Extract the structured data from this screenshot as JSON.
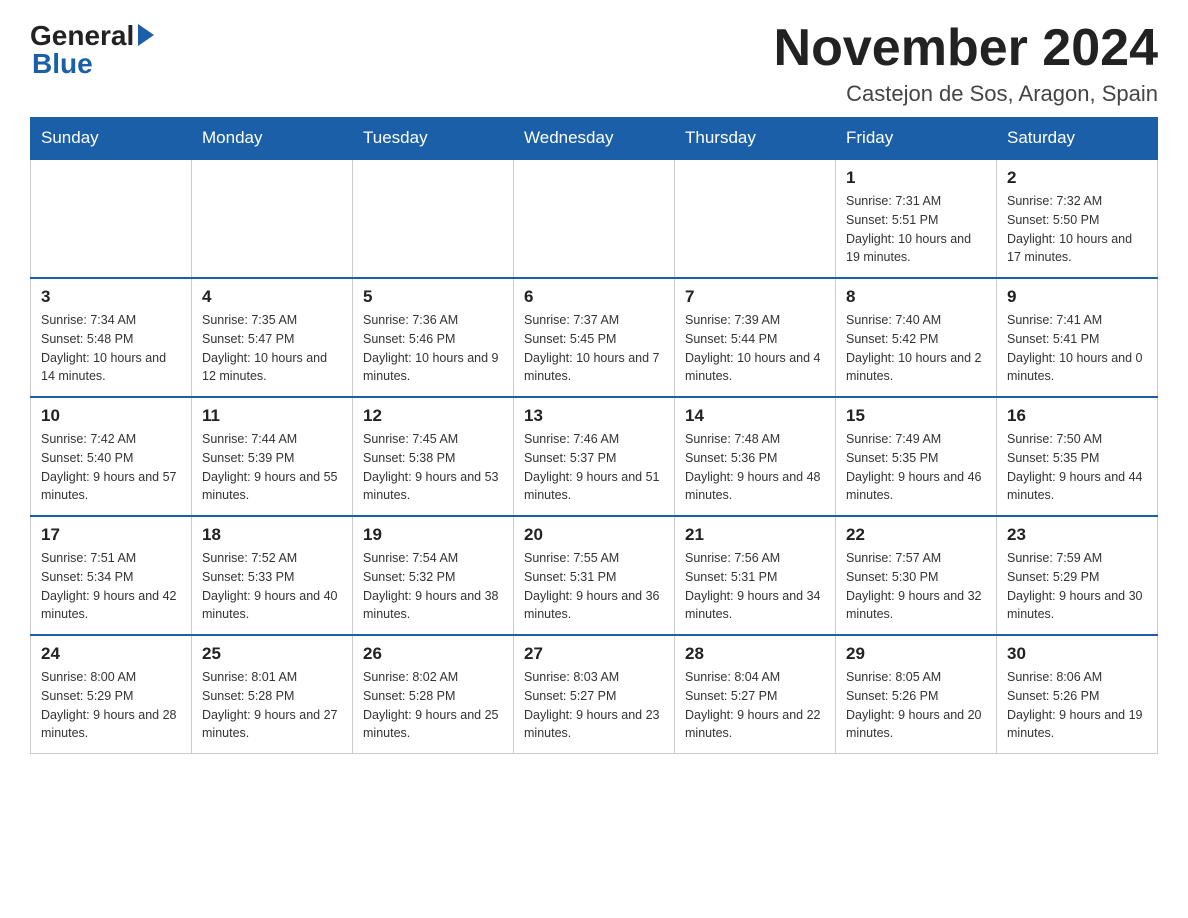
{
  "header": {
    "month_title": "November 2024",
    "location": "Castejon de Sos, Aragon, Spain"
  },
  "days_of_week": [
    "Sunday",
    "Monday",
    "Tuesday",
    "Wednesday",
    "Thursday",
    "Friday",
    "Saturday"
  ],
  "weeks": [
    [
      {
        "day": "",
        "sunrise": "",
        "sunset": "",
        "daylight": "",
        "empty": true
      },
      {
        "day": "",
        "sunrise": "",
        "sunset": "",
        "daylight": "",
        "empty": true
      },
      {
        "day": "",
        "sunrise": "",
        "sunset": "",
        "daylight": "",
        "empty": true
      },
      {
        "day": "",
        "sunrise": "",
        "sunset": "",
        "daylight": "",
        "empty": true
      },
      {
        "day": "",
        "sunrise": "",
        "sunset": "",
        "daylight": "",
        "empty": true
      },
      {
        "day": "1",
        "sunrise": "Sunrise: 7:31 AM",
        "sunset": "Sunset: 5:51 PM",
        "daylight": "Daylight: 10 hours and 19 minutes.",
        "empty": false
      },
      {
        "day": "2",
        "sunrise": "Sunrise: 7:32 AM",
        "sunset": "Sunset: 5:50 PM",
        "daylight": "Daylight: 10 hours and 17 minutes.",
        "empty": false
      }
    ],
    [
      {
        "day": "3",
        "sunrise": "Sunrise: 7:34 AM",
        "sunset": "Sunset: 5:48 PM",
        "daylight": "Daylight: 10 hours and 14 minutes.",
        "empty": false
      },
      {
        "day": "4",
        "sunrise": "Sunrise: 7:35 AM",
        "sunset": "Sunset: 5:47 PM",
        "daylight": "Daylight: 10 hours and 12 minutes.",
        "empty": false
      },
      {
        "day": "5",
        "sunrise": "Sunrise: 7:36 AM",
        "sunset": "Sunset: 5:46 PM",
        "daylight": "Daylight: 10 hours and 9 minutes.",
        "empty": false
      },
      {
        "day": "6",
        "sunrise": "Sunrise: 7:37 AM",
        "sunset": "Sunset: 5:45 PM",
        "daylight": "Daylight: 10 hours and 7 minutes.",
        "empty": false
      },
      {
        "day": "7",
        "sunrise": "Sunrise: 7:39 AM",
        "sunset": "Sunset: 5:44 PM",
        "daylight": "Daylight: 10 hours and 4 minutes.",
        "empty": false
      },
      {
        "day": "8",
        "sunrise": "Sunrise: 7:40 AM",
        "sunset": "Sunset: 5:42 PM",
        "daylight": "Daylight: 10 hours and 2 minutes.",
        "empty": false
      },
      {
        "day": "9",
        "sunrise": "Sunrise: 7:41 AM",
        "sunset": "Sunset: 5:41 PM",
        "daylight": "Daylight: 10 hours and 0 minutes.",
        "empty": false
      }
    ],
    [
      {
        "day": "10",
        "sunrise": "Sunrise: 7:42 AM",
        "sunset": "Sunset: 5:40 PM",
        "daylight": "Daylight: 9 hours and 57 minutes.",
        "empty": false
      },
      {
        "day": "11",
        "sunrise": "Sunrise: 7:44 AM",
        "sunset": "Sunset: 5:39 PM",
        "daylight": "Daylight: 9 hours and 55 minutes.",
        "empty": false
      },
      {
        "day": "12",
        "sunrise": "Sunrise: 7:45 AM",
        "sunset": "Sunset: 5:38 PM",
        "daylight": "Daylight: 9 hours and 53 minutes.",
        "empty": false
      },
      {
        "day": "13",
        "sunrise": "Sunrise: 7:46 AM",
        "sunset": "Sunset: 5:37 PM",
        "daylight": "Daylight: 9 hours and 51 minutes.",
        "empty": false
      },
      {
        "day": "14",
        "sunrise": "Sunrise: 7:48 AM",
        "sunset": "Sunset: 5:36 PM",
        "daylight": "Daylight: 9 hours and 48 minutes.",
        "empty": false
      },
      {
        "day": "15",
        "sunrise": "Sunrise: 7:49 AM",
        "sunset": "Sunset: 5:35 PM",
        "daylight": "Daylight: 9 hours and 46 minutes.",
        "empty": false
      },
      {
        "day": "16",
        "sunrise": "Sunrise: 7:50 AM",
        "sunset": "Sunset: 5:35 PM",
        "daylight": "Daylight: 9 hours and 44 minutes.",
        "empty": false
      }
    ],
    [
      {
        "day": "17",
        "sunrise": "Sunrise: 7:51 AM",
        "sunset": "Sunset: 5:34 PM",
        "daylight": "Daylight: 9 hours and 42 minutes.",
        "empty": false
      },
      {
        "day": "18",
        "sunrise": "Sunrise: 7:52 AM",
        "sunset": "Sunset: 5:33 PM",
        "daylight": "Daylight: 9 hours and 40 minutes.",
        "empty": false
      },
      {
        "day": "19",
        "sunrise": "Sunrise: 7:54 AM",
        "sunset": "Sunset: 5:32 PM",
        "daylight": "Daylight: 9 hours and 38 minutes.",
        "empty": false
      },
      {
        "day": "20",
        "sunrise": "Sunrise: 7:55 AM",
        "sunset": "Sunset: 5:31 PM",
        "daylight": "Daylight: 9 hours and 36 minutes.",
        "empty": false
      },
      {
        "day": "21",
        "sunrise": "Sunrise: 7:56 AM",
        "sunset": "Sunset: 5:31 PM",
        "daylight": "Daylight: 9 hours and 34 minutes.",
        "empty": false
      },
      {
        "day": "22",
        "sunrise": "Sunrise: 7:57 AM",
        "sunset": "Sunset: 5:30 PM",
        "daylight": "Daylight: 9 hours and 32 minutes.",
        "empty": false
      },
      {
        "day": "23",
        "sunrise": "Sunrise: 7:59 AM",
        "sunset": "Sunset: 5:29 PM",
        "daylight": "Daylight: 9 hours and 30 minutes.",
        "empty": false
      }
    ],
    [
      {
        "day": "24",
        "sunrise": "Sunrise: 8:00 AM",
        "sunset": "Sunset: 5:29 PM",
        "daylight": "Daylight: 9 hours and 28 minutes.",
        "empty": false
      },
      {
        "day": "25",
        "sunrise": "Sunrise: 8:01 AM",
        "sunset": "Sunset: 5:28 PM",
        "daylight": "Daylight: 9 hours and 27 minutes.",
        "empty": false
      },
      {
        "day": "26",
        "sunrise": "Sunrise: 8:02 AM",
        "sunset": "Sunset: 5:28 PM",
        "daylight": "Daylight: 9 hours and 25 minutes.",
        "empty": false
      },
      {
        "day": "27",
        "sunrise": "Sunrise: 8:03 AM",
        "sunset": "Sunset: 5:27 PM",
        "daylight": "Daylight: 9 hours and 23 minutes.",
        "empty": false
      },
      {
        "day": "28",
        "sunrise": "Sunrise: 8:04 AM",
        "sunset": "Sunset: 5:27 PM",
        "daylight": "Daylight: 9 hours and 22 minutes.",
        "empty": false
      },
      {
        "day": "29",
        "sunrise": "Sunrise: 8:05 AM",
        "sunset": "Sunset: 5:26 PM",
        "daylight": "Daylight: 9 hours and 20 minutes.",
        "empty": false
      },
      {
        "day": "30",
        "sunrise": "Sunrise: 8:06 AM",
        "sunset": "Sunset: 5:26 PM",
        "daylight": "Daylight: 9 hours and 19 minutes.",
        "empty": false
      }
    ]
  ],
  "logo": {
    "general": "General",
    "blue": "Blue",
    "arrow": "▶"
  }
}
